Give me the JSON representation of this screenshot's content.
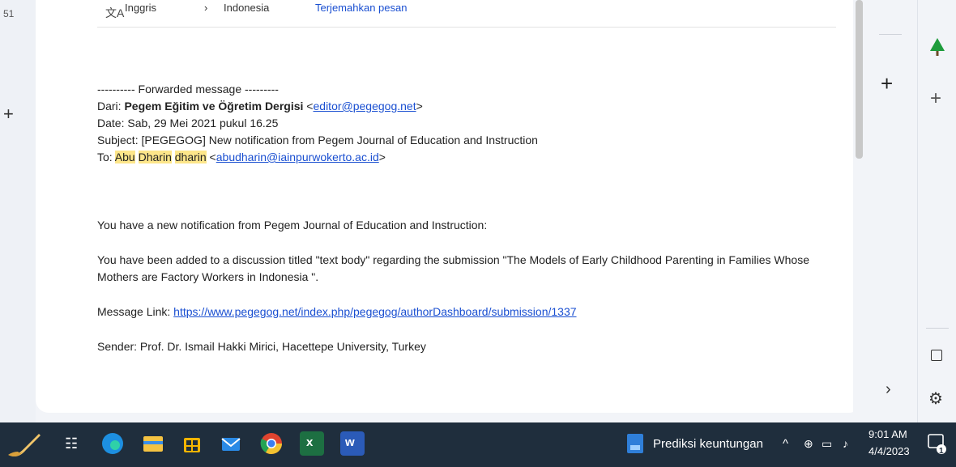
{
  "gutter": {
    "number": "51",
    "plus": "+"
  },
  "translate_bar": {
    "source_lang": "Inggris",
    "arrow": "›",
    "target_lang": "Indonesia",
    "translate_link": "Terjemahkan pesan"
  },
  "email": {
    "forwarded_header": "---------- Forwarded message ---------",
    "from_label": "Dari: ",
    "from_name": "Pegem Eğitim ve Öğretim Dergisi",
    "from_email_open": " <",
    "from_email": "editor@pegegog.net",
    "from_email_close": ">",
    "date_line": "Date: Sab, 29 Mei 2021 pukul 16.25",
    "subject_line": "Subject: [PEGEGOG] New notification from Pegem Journal of Education and Instruction",
    "to_label": "To: ",
    "to_name_1": "Abu",
    "to_name_2": "Dharin",
    "to_name_3": "dharin",
    "to_email_open": " <",
    "to_email": "abudharin@iainpurwokerto.ac.id",
    "to_email_close": ">",
    "body_1": "You have a new notification from Pegem Journal of Education and Instruction:",
    "body_2": "You have been added to a discussion titled \"text body\" regarding the submission \"The Models of Early Childhood Parenting in Families Whose Mothers are Factory Workers in Indonesia \".",
    "message_link_label": "Message Link: ",
    "message_link": "https://www.pegegog.net/index.php/pegegog/authorDashboard/submission/1337",
    "sender_line": "Sender: Prof. Dr. Ismail Hakki Mirici, Hacettepe University, Turkey"
  },
  "right_panel": {
    "plus": "+",
    "chevron": "›"
  },
  "sidebar": {
    "plus": "+",
    "gear": "⚙"
  },
  "taskbar": {
    "app_label": "Prediksi keuntungan",
    "time": "9:01 AM",
    "date": "4/4/2023",
    "tray_caret": "^",
    "notification_count": "1",
    "excel_letter": "x",
    "word_letter": "w"
  },
  "colors": {
    "highlight": "#fde68a",
    "link": "#1a4fd1",
    "taskbar": "#1f2e3d"
  }
}
